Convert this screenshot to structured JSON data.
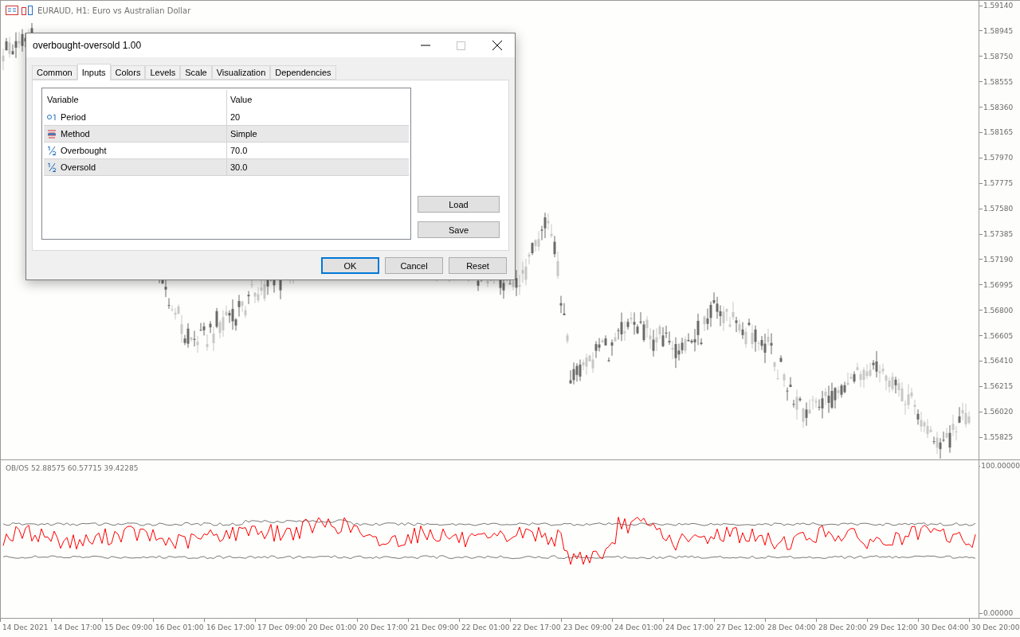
{
  "chart": {
    "title": "EURAUD, H1:  Euro vs Australian Dollar",
    "price_ticks": [
      "1.59140",
      "1.58945",
      "1.58750",
      "1.58555",
      "1.58360",
      "1.58165",
      "1.57970",
      "1.57775",
      "1.57580",
      "1.57385",
      "1.57190",
      "1.56995",
      "1.56800",
      "1.56605",
      "1.56410",
      "1.56215",
      "1.56020",
      "1.55825"
    ]
  },
  "indicator": {
    "label": "OB/OS 52.88575 60.57715 39.42285",
    "ticks": [
      "100.00000",
      "0.00000"
    ]
  },
  "time_axis": [
    "14 Dec 2021",
    "14 Dec 17:00",
    "15 Dec 09:00",
    "16 Dec 01:00",
    "16 Dec 17:00",
    "17 Dec 09:00",
    "20 Dec 01:00",
    "20 Dec 17:00",
    "21 Dec 09:00",
    "22 Dec 01:00",
    "22 Dec 17:00",
    "23 Dec 09:00",
    "24 Dec 01:00",
    "24 Dec 17:00",
    "27 Dec 12:00",
    "28 Dec 04:00",
    "28 Dec 20:00",
    "29 Dec 12:00",
    "30 Dec 04:00",
    "30 Dec 20:00"
  ],
  "dialog": {
    "title": "overbought-oversold 1.00",
    "tabs": [
      {
        "label": "Common",
        "selected": false
      },
      {
        "label": "Inputs",
        "selected": true
      },
      {
        "label": "Colors",
        "selected": false
      },
      {
        "label": "Levels",
        "selected": false
      },
      {
        "label": "Scale",
        "selected": false
      },
      {
        "label": "Visualization",
        "selected": false
      },
      {
        "label": "Dependencies",
        "selected": false
      }
    ],
    "table": {
      "columns": [
        "Variable",
        "Value"
      ],
      "rows": [
        {
          "kind": "integer",
          "variable": "Period",
          "value": "20"
        },
        {
          "kind": "enum",
          "variable": "Method",
          "value": "Simple"
        },
        {
          "kind": "double",
          "variable": "Overbought",
          "value": "70.0"
        },
        {
          "kind": "double",
          "variable": "Oversold",
          "value": "30.0"
        }
      ]
    },
    "side_buttons": [
      "Load",
      "Save"
    ],
    "buttons": [
      {
        "label": "OK",
        "default": true
      },
      {
        "label": "Cancel",
        "default": false
      },
      {
        "label": "Reset",
        "default": false
      }
    ]
  }
}
